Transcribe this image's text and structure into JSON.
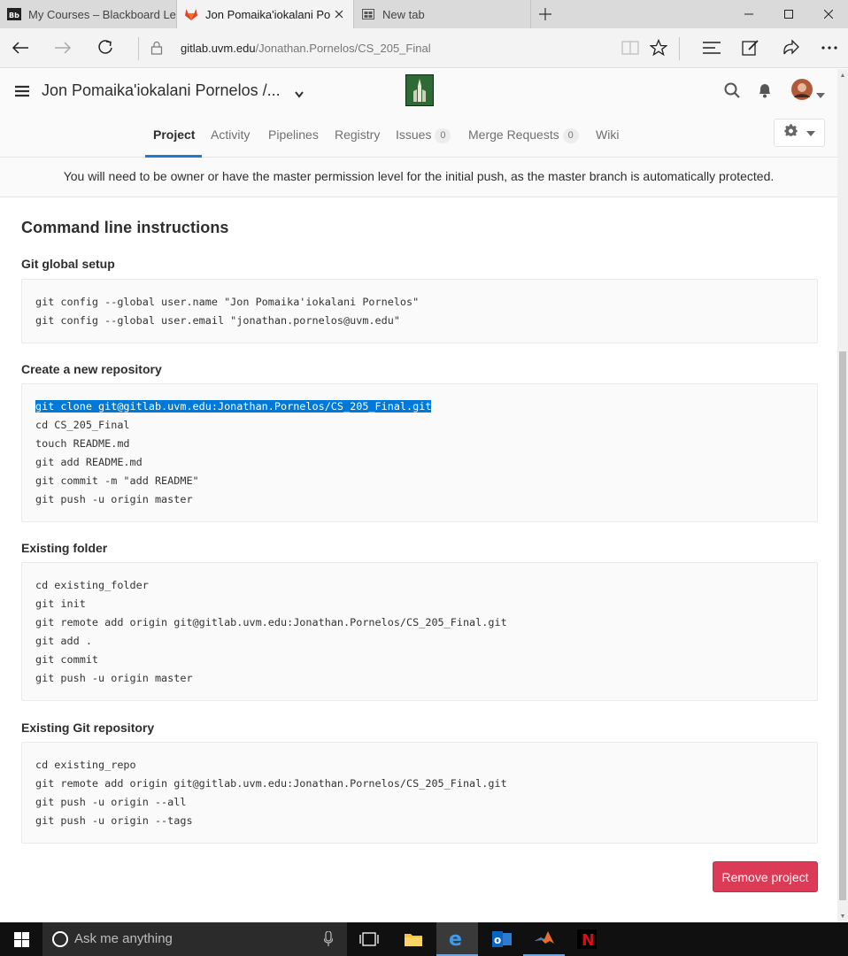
{
  "browser": {
    "tabs": [
      {
        "label": "My Courses – Blackboard Le",
        "favicon": "blackboard-icon",
        "active": false
      },
      {
        "label": "Jon Pomaika'iokalani Po",
        "favicon": "gitlab-icon",
        "active": true
      },
      {
        "label": "New tab",
        "favicon": "newtab-icon",
        "active": false
      }
    ],
    "url_host": "gitlab.uvm.edu",
    "url_path": "/Jonathan.Pornelos/CS_205_Final"
  },
  "header": {
    "project_title": "Jon Pomaika'iokalani Pornelos /..."
  },
  "nav": {
    "items": [
      {
        "label": "Project",
        "active": true
      },
      {
        "label": "Activity"
      },
      {
        "label": "Pipelines"
      },
      {
        "label": "Registry"
      },
      {
        "label": "Issues",
        "count": "0"
      },
      {
        "label": "Merge Requests",
        "count": "0"
      },
      {
        "label": "Wiki"
      }
    ]
  },
  "flash": "You will need to be owner or have the master permission level for the initial push, as the master branch is automatically protected.",
  "content": {
    "heading": "Command line instructions",
    "sections": [
      {
        "title": "Git global setup",
        "lines": [
          "git config --global user.name \"Jon Pomaika'iokalani Pornelos\"",
          "git config --global user.email \"jonathan.pornelos@uvm.edu\""
        ]
      },
      {
        "title": "Create a new repository",
        "lines": [
          "git clone git@gitlab.uvm.edu:Jonathan.Pornelos/CS_205_Final.git",
          "cd CS_205_Final",
          "touch README.md",
          "git add README.md",
          "git commit -m \"add README\"",
          "git push -u origin master"
        ]
      },
      {
        "title": "Existing folder",
        "lines": [
          "cd existing_folder",
          "git init",
          "git remote add origin git@gitlab.uvm.edu:Jonathan.Pornelos/CS_205_Final.git",
          "git add .",
          "git commit",
          "git push -u origin master"
        ]
      },
      {
        "title": "Existing Git repository",
        "lines": [
          "cd existing_repo",
          "git remote add origin git@gitlab.uvm.edu:Jonathan.Pornelos/CS_205_Final.git",
          "git push -u origin --all",
          "git push -u origin --tags"
        ]
      }
    ],
    "remove_button": "Remove project"
  },
  "taskbar": {
    "search_placeholder": "Ask me anything"
  },
  "colors": {
    "accent": "#1f78d1",
    "danger": "#db3b57",
    "selection": "#0078d7"
  }
}
